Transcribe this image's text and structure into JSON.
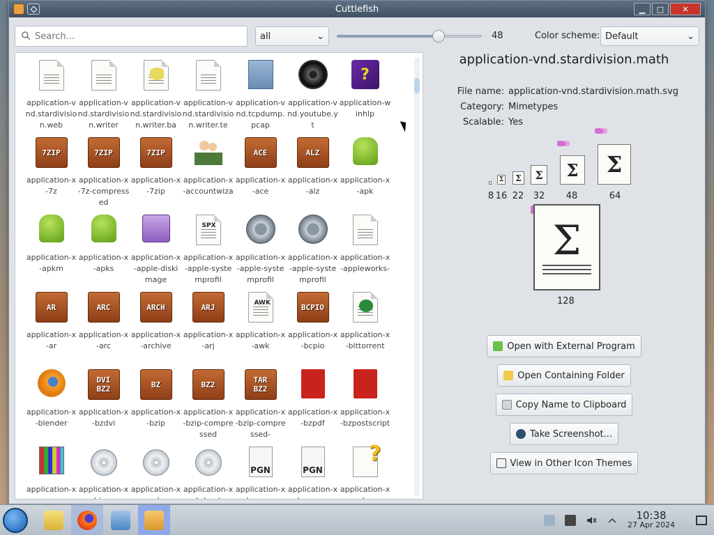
{
  "window": {
    "title": "Cuttlefish"
  },
  "toolbar": {
    "search_placeholder": "Search...",
    "filter_value": "all",
    "icon_size_value": "48",
    "icon_size_level": 48,
    "color_scheme_label": "Color scheme:",
    "color_scheme_value": "Default"
  },
  "icons": [
    {
      "label": "application-vnd.stardivision.web",
      "icon": "doc-globe-icon"
    },
    {
      "label": "application-vnd.stardivision.writer",
      "icon": "doc-writer-icon"
    },
    {
      "label": "application-vnd.stardivision.writer.ba",
      "icon": "doc-database-icon"
    },
    {
      "label": "application-vnd.stardivision.writer.te",
      "icon": "doc-template-icon"
    },
    {
      "label": "application-vnd.tcpdump.pcap",
      "icon": "nuke-icon"
    },
    {
      "label": "application-vnd.youtube.yt",
      "icon": "film-reel-icon"
    },
    {
      "label": "application-winhlp",
      "icon": "help-book-icon"
    },
    {
      "label": "application-x-7z",
      "icon": "archive-7zip-icon",
      "crate": "7ZIP"
    },
    {
      "label": "application-x-7z-compressed",
      "icon": "archive-7zip-icon",
      "crate": "7ZIP"
    },
    {
      "label": "application-x-7zip",
      "icon": "archive-7zip-icon",
      "crate": "7ZIP"
    },
    {
      "label": "application-x-accountwiza",
      "icon": "people-icon"
    },
    {
      "label": "application-x-ace",
      "icon": "archive-ace-icon",
      "crate": "ACE"
    },
    {
      "label": "application-x-alz",
      "icon": "archive-alz-icon",
      "crate": "ALZ"
    },
    {
      "label": "application-x-apk",
      "icon": "android-icon"
    },
    {
      "label": "application-x-apkm",
      "icon": "android-icon"
    },
    {
      "label": "application-x-apks",
      "icon": "android-icon"
    },
    {
      "label": "application-x-apple-diskimage",
      "icon": "floppy-icon"
    },
    {
      "label": "application-x-apple-systemprofil",
      "icon": "spx-doc-icon"
    },
    {
      "label": "application-x-apple-systemprofil",
      "icon": "gear-icon"
    },
    {
      "label": "application-x-apple-systemprofil",
      "icon": "gear-icon"
    },
    {
      "label": "application-x-appleworks-",
      "icon": "appleworks-doc-icon"
    },
    {
      "label": "application-x-ar",
      "icon": "archive-ar-icon",
      "crate": "AR"
    },
    {
      "label": "application-x-arc",
      "icon": "archive-arc-icon",
      "crate": "ARC"
    },
    {
      "label": "application-x-archive",
      "icon": "archive-arch-icon",
      "crate": "ARCH"
    },
    {
      "label": "application-x-arj",
      "icon": "archive-arj-icon",
      "crate": "ARJ"
    },
    {
      "label": "application-x-awk",
      "icon": "awk-doc-icon"
    },
    {
      "label": "application-x-bcpio",
      "icon": "archive-bcpio-icon",
      "crate": "BCPIO"
    },
    {
      "label": "application-x-bittorrent",
      "icon": "torrent-doc-icon"
    },
    {
      "label": "application-x-blender",
      "icon": "blender-icon"
    },
    {
      "label": "application-x-bzdvi",
      "icon": "archive-bzdvi-icon",
      "crate": "DVI BZ2"
    },
    {
      "label": "application-x-bzip",
      "icon": "archive-bz-icon",
      "crate": "BZ"
    },
    {
      "label": "application-x-bzip-compressed",
      "icon": "archive-bz2-icon",
      "crate": "BZ2"
    },
    {
      "label": "application-x-bzip-compressed-",
      "icon": "archive-tarbz2-icon",
      "crate": "TAR BZ2"
    },
    {
      "label": "application-x-bzpdf",
      "icon": "pdf-icon"
    },
    {
      "label": "application-x-bzpostscript",
      "icon": "postscript-icon"
    },
    {
      "label": "application-x-ccmx",
      "icon": "color-chart-icon"
    },
    {
      "label": "application-x-cd-image",
      "icon": "disc-icon"
    },
    {
      "label": "application-x-cda",
      "icon": "audio-disc-icon"
    },
    {
      "label": "application-x-cdrdao-toc",
      "icon": "toc-disc-icon"
    },
    {
      "label": "application-x-chess-pgn",
      "icon": "chess-pgn-icon"
    },
    {
      "label": "application-x-chess-pgn-",
      "icon": "chess-pgn-icon"
    },
    {
      "label": "application-x-chm",
      "icon": "chm-help-icon"
    }
  ],
  "details": {
    "title": "application-vnd.stardivision.math",
    "file_name_label": "File name:",
    "file_name": "application-vnd.stardivision.math.svg",
    "category_label": "Category:",
    "category": "Mimetypes",
    "scalable_label": "Scalable:",
    "scalable": "Yes",
    "sizes": [
      "8",
      "16",
      "22",
      "32",
      "48",
      "64"
    ],
    "large_size": "128"
  },
  "actions": {
    "open_external": "Open with External Program",
    "open_folder": "Open Containing Folder",
    "copy_name": "Copy Name to Clipboard",
    "screenshot": "Take Screenshot...",
    "other_themes": "View in Other Icon Themes"
  },
  "taskbar": {
    "time": "10:38",
    "date": "27 Apr 2024"
  },
  "colors": {
    "accent": "#3daee9",
    "title_bar": "#4b5d70",
    "close": "#c8352c"
  }
}
